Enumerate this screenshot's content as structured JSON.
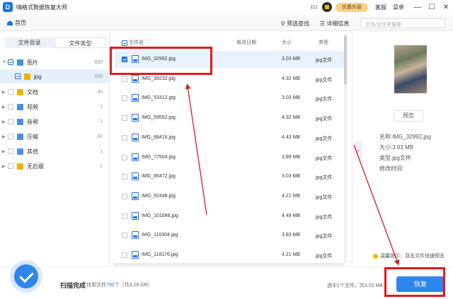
{
  "app": {
    "title": "嗨格式数据恢复大师",
    "num": "111",
    "upgrade_label": "优惠升级",
    "support_label": "客服",
    "menu_label": "菜单"
  },
  "window": {
    "minimize": "—",
    "maximize": "☐",
    "close": "✕"
  },
  "nav": {
    "home_label": "首页",
    "filter_label": "筛选查找",
    "details_label": "详细信息",
    "search_placeholder": "文件/文件夹搜索"
  },
  "sidebar": {
    "tabs": [
      {
        "label": "文件目录",
        "active": false
      },
      {
        "label": "文件类型",
        "active": true
      }
    ],
    "items": [
      {
        "label": "图片",
        "count": "699",
        "color": "#4a90e2",
        "expanded": true
      },
      {
        "label": "jpg",
        "count": "699",
        "color": "#f0b400",
        "child": true
      },
      {
        "label": "文档",
        "count": "30",
        "color": "#f0b400"
      },
      {
        "label": "视频",
        "count": "1",
        "color": "#4a90e2"
      },
      {
        "label": "音频",
        "count": "1",
        "color": "#4a90e2"
      },
      {
        "label": "压缩",
        "count": "60",
        "color": "#4a90e2"
      },
      {
        "label": "其他",
        "count": "1",
        "color": "#4a90e2"
      },
      {
        "label": "无后缀",
        "count": "1",
        "color": "#f0b400"
      }
    ]
  },
  "table": {
    "headers": {
      "name": "文件名",
      "sort": "↑",
      "modified": "修改日期",
      "size": "大小",
      "type": "类型"
    },
    "rows": [
      {
        "name": "IMG_32992.jpg",
        "size": "3.03 MB",
        "type": "jpg文件",
        "checked": true
      },
      {
        "name": "IMG_39232.jpg",
        "size": "4.32 MB",
        "type": "jpg文件",
        "checked": false
      },
      {
        "name": "IMG_53312.jpg",
        "size": "3.03 MB",
        "type": "jpg文件",
        "checked": false
      },
      {
        "name": "IMG_59552.jpg",
        "size": "4.32 MB",
        "type": "jpg文件",
        "checked": false
      },
      {
        "name": "IMG_68416.jpg",
        "size": "4.43 MB",
        "type": "jpg文件",
        "checked": false
      },
      {
        "name": "IMG_77504.jpg",
        "size": "3.89 MB",
        "type": "jpg文件",
        "checked": false
      },
      {
        "name": "IMG_85472.jpg",
        "size": "3.03 MB",
        "type": "jpg文件",
        "checked": false
      },
      {
        "name": "IMG_92448.jpg",
        "size": "4.21 MB",
        "type": "jpg文件",
        "checked": false
      },
      {
        "name": "IMG_101088.jpg",
        "size": "4.49 MB",
        "type": "jpg文件",
        "checked": false
      },
      {
        "name": "IMG_110304.jpg",
        "size": "3.83 MB",
        "type": "jpg文件",
        "checked": false
      },
      {
        "name": "IMG_118176.jpg",
        "size": "4.21 MB",
        "type": "jpg文件",
        "checked": false
      }
    ]
  },
  "preview": {
    "button_label": "预览",
    "name": "名称:IMG_32992.jpg",
    "size": "大小:3.03 MB",
    "type": "类型:jpg文件",
    "modified": "修改时间:",
    "tip": "温馨提示：双击文件快速预览",
    "collapse": "›"
  },
  "footer": {
    "status": "扫描完成",
    "found_prefix": "找到文件",
    "found_count": "792",
    "found_suffix": "个（共3.26 GB）",
    "selected_info": "选中1个文件，共3.03 MB",
    "recover_label": "恢复"
  },
  "colors": {
    "accent": "#2f86ea",
    "annotation": "#e11a1a",
    "upgrade": "#f7d28b"
  }
}
